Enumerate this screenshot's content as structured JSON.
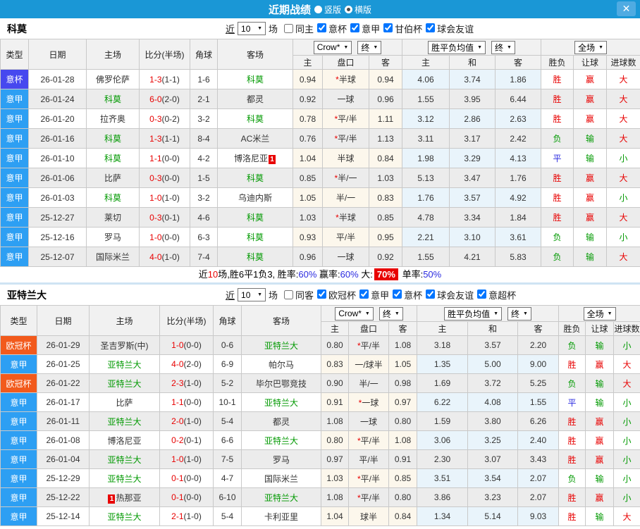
{
  "title_bar": {
    "title": "近期战绩",
    "vertical_label": "竖版",
    "horizontal_label": "横版",
    "selected_layout": "横版",
    "close_label": "✕"
  },
  "colors": {
    "titlebar_blue": "#1a97d6",
    "type_map": {
      "意杯": "#4648ef",
      "意甲": "#2d9ff3",
      "欧冠杯": "#f25a1c"
    },
    "result_map": {
      "胜": "#e80000",
      "负": "#009900",
      "平": "#2b2be0",
      "赢": "#e80000",
      "输": "#009900",
      "大": "#e80000",
      "小": "#009900"
    },
    "team_green": "#009900",
    "score_red": "#e80000",
    "badge_red": "#e80000"
  },
  "table_header": {
    "type": "类型",
    "date": "日期",
    "home": "主场",
    "score": "比分(半场)",
    "corner": "角球",
    "away": "客场",
    "dd_company": "Crow*",
    "dd_final1": "终",
    "dd_mean": "胜平负均值",
    "dd_final2": "终",
    "dd_scope": "全场",
    "sub": {
      "home": "主",
      "handicap": "盘口",
      "away": "客",
      "mean_home": "主",
      "mean_draw": "和",
      "mean_away": "客",
      "wdl": "胜负",
      "handi_result": "让球",
      "goals": "进球数"
    }
  },
  "sections": [
    {
      "team": "科莫",
      "filter": {
        "near_label": "近",
        "games": "10",
        "unit_label": "场",
        "same_side_label": "同主",
        "same_side_checked": false,
        "competitions": [
          "意杯",
          "意甲",
          "甘伯杯",
          "球会友谊"
        ]
      },
      "rows": [
        {
          "type": "意杯",
          "date": "26-01-28",
          "home": "佛罗伦萨",
          "home_green": false,
          "home_badge": null,
          "score": "1-3",
          "half": "(1-1)",
          "corner": "1-6",
          "away": "科莫",
          "away_green": true,
          "away_badge": null,
          "odds": [
            "0.94",
            "*半球",
            "0.94"
          ],
          "mean": [
            "4.06",
            "3.74",
            "1.86"
          ],
          "result": [
            "胜",
            "赢",
            "大"
          ]
        },
        {
          "type": "意甲",
          "date": "26-01-24",
          "home": "科莫",
          "home_green": true,
          "home_badge": null,
          "score": "6-0",
          "half": "(2-0)",
          "corner": "2-1",
          "away": "都灵",
          "away_green": false,
          "away_badge": null,
          "odds": [
            "0.92",
            "一球",
            "0.96"
          ],
          "mean": [
            "1.55",
            "3.95",
            "6.44"
          ],
          "result": [
            "胜",
            "赢",
            "大"
          ]
        },
        {
          "type": "意甲",
          "date": "26-01-20",
          "home": "拉齐奥",
          "home_green": false,
          "home_badge": null,
          "score": "0-3",
          "half": "(0-2)",
          "corner": "3-2",
          "away": "科莫",
          "away_green": true,
          "away_badge": null,
          "odds": [
            "0.78",
            "*平/半",
            "1.11"
          ],
          "mean": [
            "3.12",
            "2.86",
            "2.63"
          ],
          "result": [
            "胜",
            "赢",
            "大"
          ]
        },
        {
          "type": "意甲",
          "date": "26-01-16",
          "home": "科莫",
          "home_green": true,
          "home_badge": null,
          "score": "1-3",
          "half": "(1-1)",
          "corner": "8-4",
          "away": "AC米兰",
          "away_green": false,
          "away_badge": null,
          "odds": [
            "0.76",
            "*平/半",
            "1.13"
          ],
          "mean": [
            "3.11",
            "3.17",
            "2.42"
          ],
          "result": [
            "负",
            "输",
            "大"
          ]
        },
        {
          "type": "意甲",
          "date": "26-01-10",
          "home": "科莫",
          "home_green": true,
          "home_badge": null,
          "score": "1-1",
          "half": "(0-0)",
          "corner": "4-2",
          "away": "博洛尼亚",
          "away_green": false,
          "away_badge": {
            "text": "1",
            "pos": "after"
          },
          "odds": [
            "1.04",
            "半球",
            "0.84"
          ],
          "mean": [
            "1.98",
            "3.29",
            "4.13"
          ],
          "result": [
            "平",
            "输",
            "小"
          ]
        },
        {
          "type": "意甲",
          "date": "26-01-06",
          "home": "比萨",
          "home_green": false,
          "home_badge": null,
          "score": "0-3",
          "half": "(0-0)",
          "corner": "1-5",
          "away": "科莫",
          "away_green": true,
          "away_badge": null,
          "odds": [
            "0.85",
            "*半/一",
            "1.03"
          ],
          "mean": [
            "5.13",
            "3.47",
            "1.76"
          ],
          "result": [
            "胜",
            "赢",
            "大"
          ]
        },
        {
          "type": "意甲",
          "date": "26-01-03",
          "home": "科莫",
          "home_green": true,
          "home_badge": null,
          "score": "1-0",
          "half": "(1-0)",
          "corner": "3-2",
          "away": "乌迪内斯",
          "away_green": false,
          "away_badge": null,
          "odds": [
            "1.05",
            "半/一",
            "0.83"
          ],
          "mean": [
            "1.76",
            "3.57",
            "4.92"
          ],
          "result": [
            "胜",
            "赢",
            "小"
          ]
        },
        {
          "type": "意甲",
          "date": "25-12-27",
          "home": "莱切",
          "home_green": false,
          "home_badge": null,
          "score": "0-3",
          "half": "(0-1)",
          "corner": "4-6",
          "away": "科莫",
          "away_green": true,
          "away_badge": null,
          "odds": [
            "1.03",
            "*半球",
            "0.85"
          ],
          "mean": [
            "4.78",
            "3.34",
            "1.84"
          ],
          "result": [
            "胜",
            "赢",
            "大"
          ]
        },
        {
          "type": "意甲",
          "date": "25-12-16",
          "home": "罗马",
          "home_green": false,
          "home_badge": null,
          "score": "1-0",
          "half": "(0-0)",
          "corner": "6-3",
          "away": "科莫",
          "away_green": true,
          "away_badge": null,
          "odds": [
            "0.93",
            "平/半",
            "0.95"
          ],
          "mean": [
            "2.21",
            "3.10",
            "3.61"
          ],
          "result": [
            "负",
            "输",
            "小"
          ]
        },
        {
          "type": "意甲",
          "date": "25-12-07",
          "home": "国际米兰",
          "home_green": false,
          "home_badge": null,
          "score": "4-0",
          "half": "(1-0)",
          "corner": "7-4",
          "away": "科莫",
          "away_green": true,
          "away_badge": null,
          "odds": [
            "0.96",
            "一球",
            "0.92"
          ],
          "mean": [
            "1.55",
            "4.21",
            "5.83"
          ],
          "result": [
            "负",
            "输",
            "大"
          ]
        }
      ],
      "summary": [
        {
          "t": "近"
        },
        {
          "t": "10",
          "s": "red"
        },
        {
          "t": "场,胜6平1负3, 胜率:"
        },
        {
          "t": "60%",
          "s": "blue"
        },
        {
          "t": " 赢率:"
        },
        {
          "t": "60%",
          "s": "blue"
        },
        {
          "t": " 大:"
        },
        {
          "t": "70%",
          "s": "redbox"
        },
        {
          "t": " 单率:"
        },
        {
          "t": "50%",
          "s": "blue"
        }
      ]
    },
    {
      "team": "亚特兰大",
      "filter": {
        "near_label": "近",
        "games": "10",
        "unit_label": "场",
        "same_side_label": "同客",
        "same_side_checked": false,
        "competitions": [
          "欧冠杯",
          "意甲",
          "意杯",
          "球会友谊",
          "意超杯"
        ]
      },
      "rows": [
        {
          "type": "欧冠杯",
          "date": "26-01-29",
          "home": "圣吉罗斯(中)",
          "home_green": false,
          "home_badge": null,
          "score": "1-0",
          "half": "(0-0)",
          "corner": "0-6",
          "away": "亚特兰大",
          "away_green": true,
          "away_badge": null,
          "odds": [
            "0.80",
            "*平/半",
            "1.08"
          ],
          "mean": [
            "3.18",
            "3.57",
            "2.20"
          ],
          "result": [
            "负",
            "输",
            "小"
          ]
        },
        {
          "type": "意甲",
          "date": "26-01-25",
          "home": "亚特兰大",
          "home_green": true,
          "home_badge": null,
          "score": "4-0",
          "half": "(2-0)",
          "corner": "6-9",
          "away": "帕尔马",
          "away_green": false,
          "away_badge": null,
          "odds": [
            "0.83",
            "一/球半",
            "1.05"
          ],
          "mean": [
            "1.35",
            "5.00",
            "9.00"
          ],
          "result": [
            "胜",
            "赢",
            "大"
          ]
        },
        {
          "type": "欧冠杯",
          "date": "26-01-22",
          "home": "亚特兰大",
          "home_green": true,
          "home_badge": null,
          "score": "2-3",
          "half": "(1-0)",
          "corner": "5-2",
          "away": "毕尔巴鄂竞技",
          "away_green": false,
          "away_badge": null,
          "odds": [
            "0.90",
            "半/一",
            "0.98"
          ],
          "mean": [
            "1.69",
            "3.72",
            "5.25"
          ],
          "result": [
            "负",
            "输",
            "大"
          ]
        },
        {
          "type": "意甲",
          "date": "26-01-17",
          "home": "比萨",
          "home_green": false,
          "home_badge": null,
          "score": "1-1",
          "half": "(0-0)",
          "corner": "10-1",
          "away": "亚特兰大",
          "away_green": true,
          "away_badge": null,
          "odds": [
            "0.91",
            "*一球",
            "0.97"
          ],
          "mean": [
            "6.22",
            "4.08",
            "1.55"
          ],
          "result": [
            "平",
            "输",
            "小"
          ]
        },
        {
          "type": "意甲",
          "date": "26-01-11",
          "home": "亚特兰大",
          "home_green": true,
          "home_badge": null,
          "score": "2-0",
          "half": "(1-0)",
          "corner": "5-4",
          "away": "都灵",
          "away_green": false,
          "away_badge": null,
          "odds": [
            "1.08",
            "一球",
            "0.80"
          ],
          "mean": [
            "1.59",
            "3.80",
            "6.26"
          ],
          "result": [
            "胜",
            "赢",
            "小"
          ]
        },
        {
          "type": "意甲",
          "date": "26-01-08",
          "home": "博洛尼亚",
          "home_green": false,
          "home_badge": null,
          "score": "0-2",
          "half": "(0-1)",
          "corner": "6-6",
          "away": "亚特兰大",
          "away_green": true,
          "away_badge": null,
          "odds": [
            "0.80",
            "*平/半",
            "1.08"
          ],
          "mean": [
            "3.06",
            "3.25",
            "2.40"
          ],
          "result": [
            "胜",
            "赢",
            "小"
          ]
        },
        {
          "type": "意甲",
          "date": "26-01-04",
          "home": "亚特兰大",
          "home_green": true,
          "home_badge": null,
          "score": "1-0",
          "half": "(1-0)",
          "corner": "7-5",
          "away": "罗马",
          "away_green": false,
          "away_badge": null,
          "odds": [
            "0.97",
            "平/半",
            "0.91"
          ],
          "mean": [
            "2.30",
            "3.07",
            "3.43"
          ],
          "result": [
            "胜",
            "赢",
            "小"
          ]
        },
        {
          "type": "意甲",
          "date": "25-12-29",
          "home": "亚特兰大",
          "home_green": true,
          "home_badge": null,
          "score": "0-1",
          "half": "(0-0)",
          "corner": "4-7",
          "away": "国际米兰",
          "away_green": false,
          "away_badge": null,
          "odds": [
            "1.03",
            "*平/半",
            "0.85"
          ],
          "mean": [
            "3.51",
            "3.54",
            "2.07"
          ],
          "result": [
            "负",
            "输",
            "小"
          ]
        },
        {
          "type": "意甲",
          "date": "25-12-22",
          "home": "热那亚",
          "home_green": false,
          "home_badge": {
            "text": "1",
            "pos": "before"
          },
          "score": "0-1",
          "half": "(0-0)",
          "corner": "6-10",
          "away": "亚特兰大",
          "away_green": true,
          "away_badge": null,
          "odds": [
            "1.08",
            "*平/半",
            "0.80"
          ],
          "mean": [
            "3.86",
            "3.23",
            "2.07"
          ],
          "result": [
            "胜",
            "赢",
            "小"
          ]
        },
        {
          "type": "意甲",
          "date": "25-12-14",
          "home": "亚特兰大",
          "home_green": true,
          "home_badge": null,
          "score": "2-1",
          "half": "(1-0)",
          "corner": "5-4",
          "away": "卡利亚里",
          "away_green": false,
          "away_badge": null,
          "odds": [
            "1.04",
            "球半",
            "0.84"
          ],
          "mean": [
            "1.34",
            "5.14",
            "9.03"
          ],
          "result": [
            "胜",
            "输",
            "大"
          ]
        }
      ],
      "summary": null
    }
  ]
}
